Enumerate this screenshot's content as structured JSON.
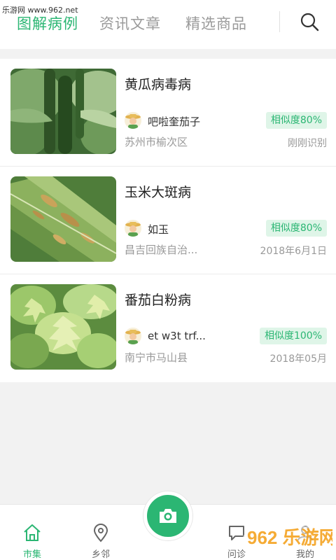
{
  "watermark_top": "乐游网 www.962.net",
  "tabs": [
    {
      "label": "图解病例",
      "active": true
    },
    {
      "label": "资讯文章",
      "active": false
    },
    {
      "label": "精选商品",
      "active": false
    }
  ],
  "accent_color": "#2bb673",
  "cases": [
    {
      "title": "黄瓜病毒病",
      "user": "吧啦奎茄子",
      "similarity": "相似度80%",
      "location": "苏州市榆次区",
      "time": "刚刚识别",
      "image": "cucumber-plant"
    },
    {
      "title": "玉米大斑病",
      "user": "如玉",
      "similarity": "相似度80%",
      "location": "昌吉回族自治...",
      "time": "2018年6月1日",
      "image": "corn-leaf"
    },
    {
      "title": "番茄白粉病",
      "user": "et w3t trf...",
      "similarity": "相似度100%",
      "location": "南宁市马山县",
      "time": "2018年05月",
      "image": "tomato-leaves"
    }
  ],
  "bottom_nav": {
    "market": "市集",
    "neighbors": "乡邻",
    "ask": "问诊",
    "mine": "我的"
  },
  "watermark_logo": "962 乐游网"
}
